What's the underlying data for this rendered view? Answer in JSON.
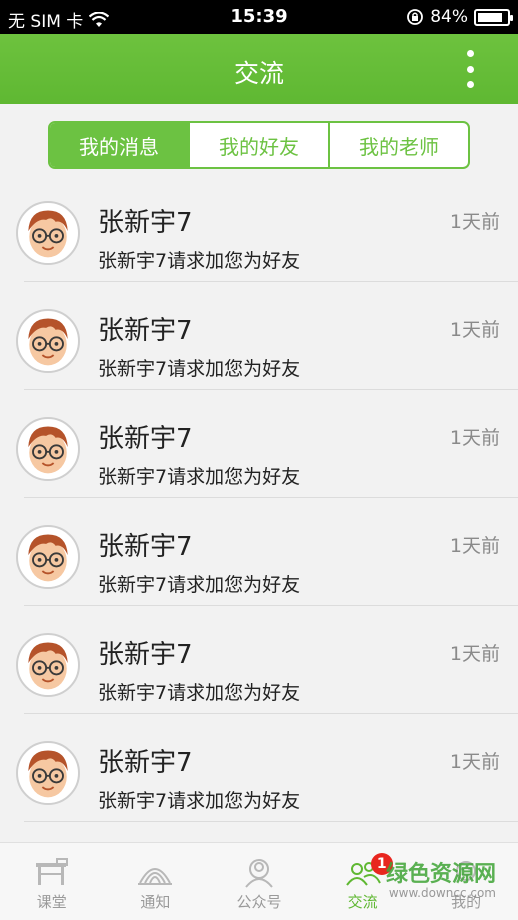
{
  "status_bar": {
    "carrier": "无 SIM 卡",
    "time": "15:39",
    "battery": "84%",
    "battery_level": 0.84
  },
  "header": {
    "title": "交流"
  },
  "segments": [
    {
      "label": "我的消息",
      "active": true
    },
    {
      "label": "我的好友",
      "active": false
    },
    {
      "label": "我的老师",
      "active": false
    }
  ],
  "messages": [
    {
      "name": "张新宇7",
      "time": "1天前",
      "text": "张新宇7请求加您为好友"
    },
    {
      "name": "张新宇7",
      "time": "1天前",
      "text": "张新宇7请求加您为好友"
    },
    {
      "name": "张新宇7",
      "time": "1天前",
      "text": "张新宇7请求加您为好友"
    },
    {
      "name": "张新宇7",
      "time": "1天前",
      "text": "张新宇7请求加您为好友"
    },
    {
      "name": "张新宇7",
      "time": "1天前",
      "text": "张新宇7请求加您为好友"
    },
    {
      "name": "张新宇7",
      "time": "1天前",
      "text": "张新宇7请求加您为好友"
    }
  ],
  "tabbar": [
    {
      "label": "课堂",
      "icon": "classroom-icon"
    },
    {
      "label": "通知",
      "icon": "notice-icon"
    },
    {
      "label": "公众号",
      "icon": "public-account-icon"
    },
    {
      "label": "交流",
      "icon": "chat-icon",
      "active": true,
      "badge": "1"
    },
    {
      "label": "我的",
      "icon": "profile-icon"
    }
  ],
  "watermark": {
    "text": "绿色资源网",
    "sub": "www.downcc.com"
  },
  "colors": {
    "brand_green": "#6cc242",
    "badge_red": "#e8261f"
  }
}
